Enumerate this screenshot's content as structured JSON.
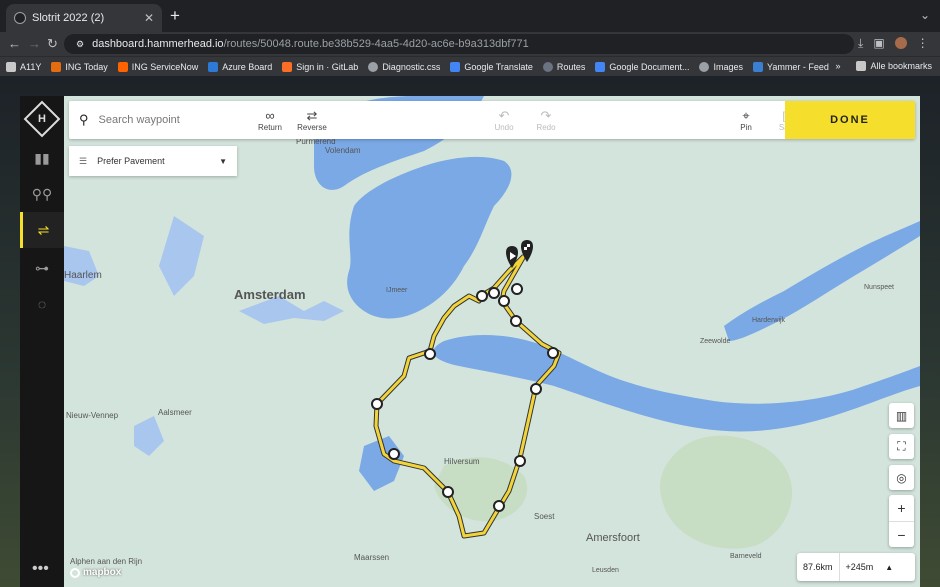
{
  "browser": {
    "tab_title": "Slotrit 2022 (2)",
    "tab_close": "✕",
    "new_tab": "+",
    "url_host": "dashboard.hammerhead.io",
    "url_path": "/routes/50048.route.be38b529-4aa5-4d20-ac6e-b9a313dbf771"
  },
  "bookmarks": [
    {
      "label": "A11Y",
      "color": "#c8c8c8"
    },
    {
      "label": "ING Today",
      "color": "#e66c12"
    },
    {
      "label": "ING ServiceNow",
      "color": "#ff6200"
    },
    {
      "label": "Azure Board",
      "color": "#2f79d6"
    },
    {
      "label": "Sign in · GitLab",
      "color": "#fc6d26"
    },
    {
      "label": "Diagnostic.css",
      "color": "#9aa0a6"
    },
    {
      "label": "Google Translate",
      "color": "#4285f4"
    },
    {
      "label": "Routes",
      "color": "#6b7280"
    },
    {
      "label": "Google Document...",
      "color": "#4285f4"
    },
    {
      "label": "Images",
      "color": "#9aa0a6"
    },
    {
      "label": "Yammer - Feed",
      "color": "#3b7fd3"
    }
  ],
  "bookmarks_more": "»",
  "bookmarks_all": "Alle bookmarks",
  "toolbar": {
    "search_placeholder": "Search waypoint",
    "return_label": "Return",
    "reverse_label": "Reverse",
    "undo_label": "Undo",
    "redo_label": "Redo",
    "pin_label": "Pin",
    "save_label": "Save",
    "done_label": "DONE"
  },
  "routing_pref": "Prefer Pavement",
  "stats": {
    "distance": "87.6km",
    "elevation": "+245m"
  },
  "map_labels": {
    "purmerend": "Purmerend",
    "volendam": "Volendam",
    "haarlem": "Haarlem",
    "amsterdam": "Amsterdam",
    "ijmeer": "IJmeer",
    "nunspeet": "Nunspeet",
    "harderwijk": "Harderwijk",
    "zeewolde": "Zeewolde",
    "nieuw_vennep": "Nieuw-Vennep",
    "aalsmeer": "Aalsmeer",
    "hilversum": "Hilversum",
    "soest": "Soest",
    "amersfoort": "Amersfoort",
    "barneveld": "Barneveld",
    "alphen": "Alphen aan den Rijn",
    "maarssen": "Maarssen",
    "leusden": "Leusden"
  },
  "attribution": "mapbox",
  "colors": {
    "accent": "#f5df2c",
    "route": "#f2d43a",
    "water": "#7aa9e6",
    "land": "#d3e4dc"
  }
}
